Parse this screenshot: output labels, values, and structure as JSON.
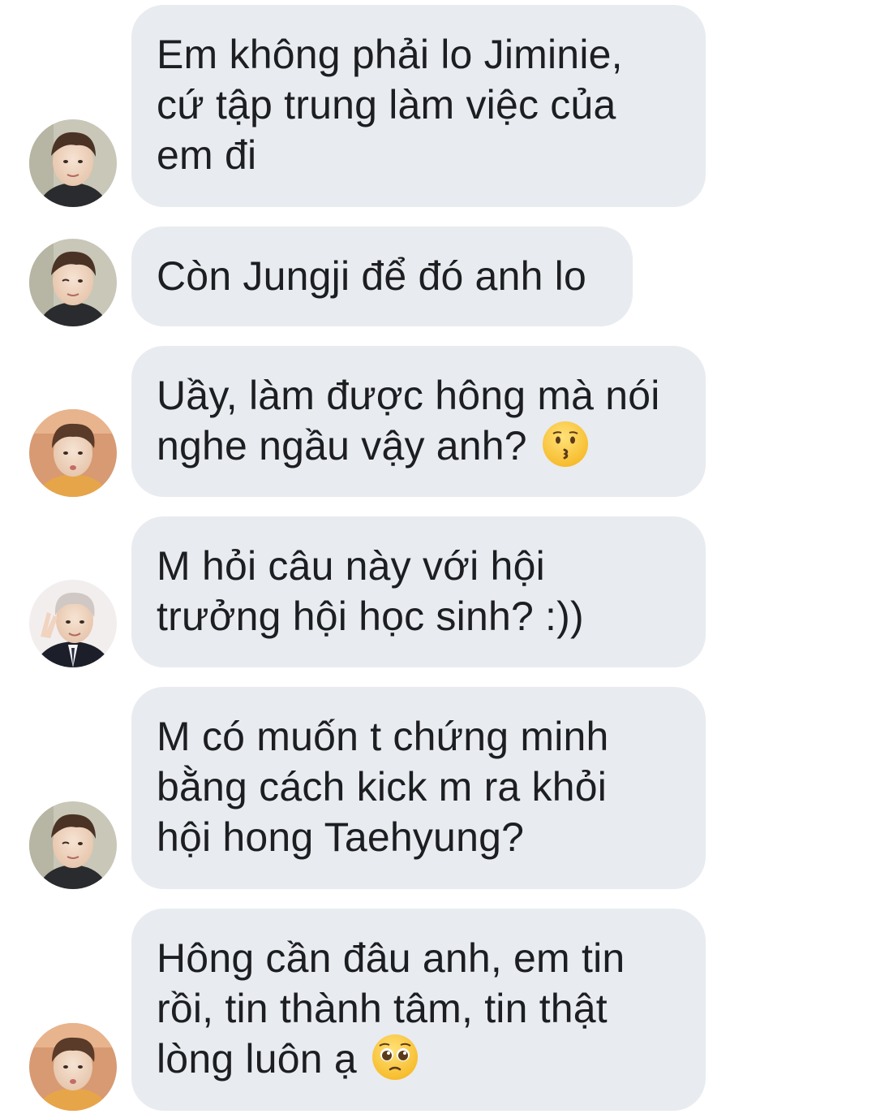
{
  "conversation": {
    "messages": [
      {
        "sender": "jin",
        "lines": [
          "Em không phải lo Jiminie,",
          "cứ tập trung làm việc của",
          "em đi"
        ]
      },
      {
        "sender": "jin",
        "lines": [
          "Còn Jungji để đó anh lo"
        ]
      },
      {
        "sender": "taehyung",
        "lines": [
          "Uầy, làm được hông mà nói",
          "nghe ngầu vậy anh?"
        ],
        "emoji": "kissing-face-emoji"
      },
      {
        "sender": "namjoon",
        "lines": [
          "M hỏi câu này với hội",
          "trưởng hội học sinh? :))"
        ]
      },
      {
        "sender": "jin",
        "lines": [
          "M có muốn t chứng minh",
          "bằng cách kick m ra khỏi",
          "hội hong Taehyung?"
        ]
      },
      {
        "sender": "taehyung",
        "lines": [
          "Hông cần đâu anh, em tin",
          "rồi, tin thành tâm, tin thật",
          "lòng luôn ạ"
        ],
        "emoji": "pleading-face-emoji"
      }
    ]
  },
  "colors": {
    "bubble": "#e8ebef",
    "text": "#1c1e21",
    "background": "#ffffff"
  }
}
